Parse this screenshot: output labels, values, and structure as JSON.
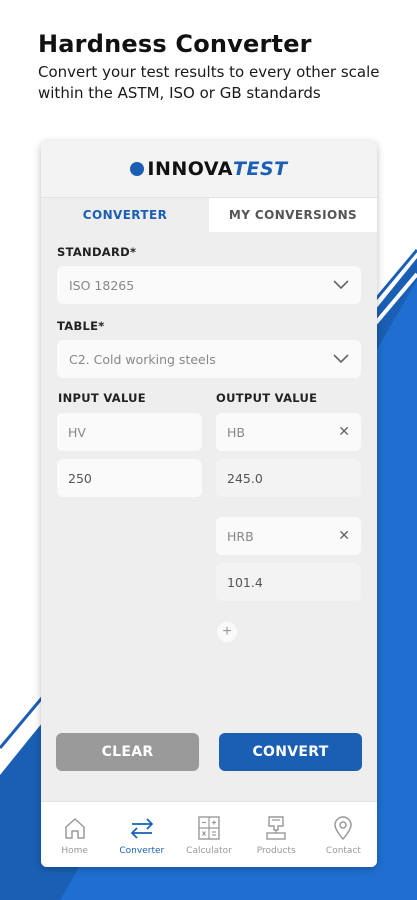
{
  "promo": {
    "title": "Hardness Converter",
    "subtitle": "Convert your test results to every other scale within the ASTM, ISO or GB standards"
  },
  "app": {
    "logo_prefix": "INNOVA",
    "logo_suffix": "TEST",
    "tabs": [
      {
        "label": "CONVERTER",
        "active": true
      },
      {
        "label": "MY CONVERSIONS",
        "active": false
      }
    ],
    "standard": {
      "label": "STANDARD*",
      "value": "ISO 18265"
    },
    "table": {
      "label": "TABLE*",
      "value": "C2. Cold working steels"
    },
    "input": {
      "label": "INPUT VALUE",
      "scale": "HV",
      "value": "250"
    },
    "output": {
      "label": "OUTPUT VALUE",
      "results": [
        {
          "scale": "HB",
          "value": "245.0"
        },
        {
          "scale": "HRB",
          "value": "101.4"
        }
      ]
    },
    "buttons": {
      "clear": "CLEAR",
      "convert": "CONVERT"
    },
    "nav": [
      {
        "label": "Home",
        "icon": "home-icon",
        "active": false
      },
      {
        "label": "Converter",
        "icon": "swap-arrows-icon",
        "active": true
      },
      {
        "label": "Calculator",
        "icon": "calculator-icon",
        "active": false
      },
      {
        "label": "Products",
        "icon": "hardness-tester-icon",
        "active": false
      },
      {
        "label": "Contact",
        "icon": "location-pin-icon",
        "active": false
      }
    ]
  },
  "colors": {
    "accent": "#1a5fb4",
    "clear_button": "#9a9a9a",
    "background_stripe": "#1a5fb4"
  }
}
